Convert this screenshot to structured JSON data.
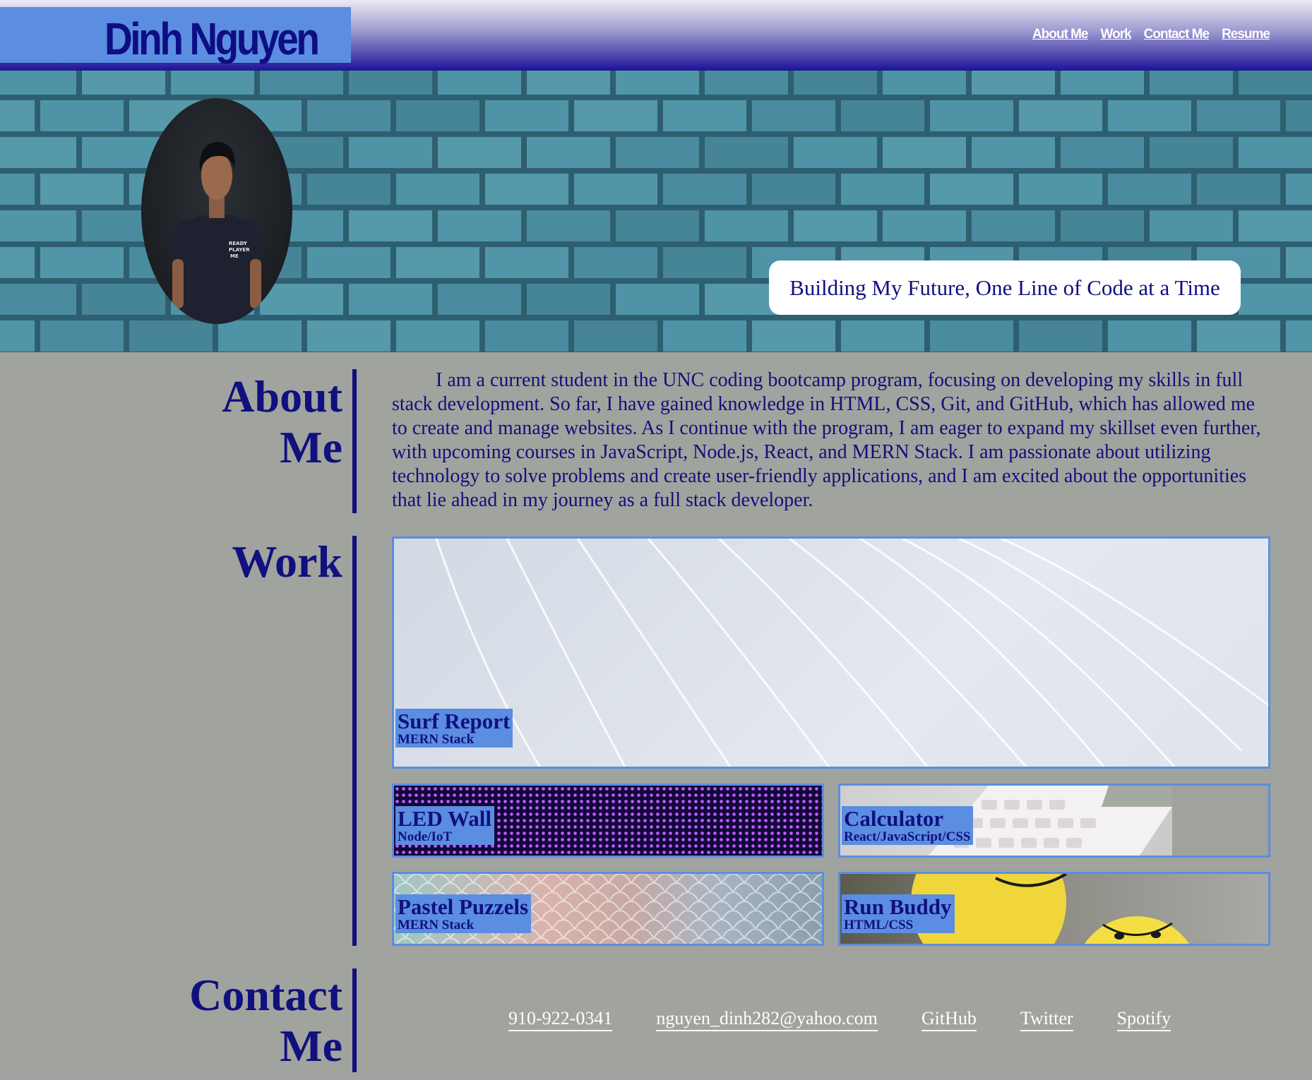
{
  "header": {
    "name": "Dinh Nguyen",
    "nav": [
      "About Me",
      "Work",
      "Contact Me",
      "Resume"
    ]
  },
  "hero": {
    "tagline": "Building My Future, One Line of Code at a Time"
  },
  "about": {
    "title_line1": "About",
    "title_line2": "Me",
    "text": "I am a current student in the UNC coding bootcamp program, focusing on developing my skills in full stack development. So far, I have gained knowledge in HTML, CSS, Git, and GitHub, which has allowed me to create and manage websites. As I continue with the program, I am eager to expand my skillset even further, with upcoming courses in JavaScript, Node.js, React, and MERN Stack. I am passionate about utilizing technology to solve problems and create user-friendly applications, and I am excited about the opportunities that lie ahead in my journey as a full stack developer."
  },
  "work": {
    "title": "Work",
    "projects": [
      {
        "title": "Surf Report",
        "tech": "MERN Stack"
      },
      {
        "title": "LED Wall",
        "tech": "Node/IoT"
      },
      {
        "title": "Calculator",
        "tech": "React/JavaScript/CSS"
      },
      {
        "title": "Pastel Puzzels",
        "tech": "MERN Stack"
      },
      {
        "title": "Run Buddy",
        "tech": "HTML/CSS"
      }
    ]
  },
  "contact": {
    "title_line1": "Contact",
    "title_line2": "Me",
    "links": [
      "910-922-0341",
      "nguyen_dinh282@yahoo.com",
      "GitHub",
      "Twitter",
      "Spotify"
    ]
  },
  "colors": {
    "background": "#a1a39e",
    "accent_blue": "#5b8de1",
    "navy_text": "#10107e"
  }
}
